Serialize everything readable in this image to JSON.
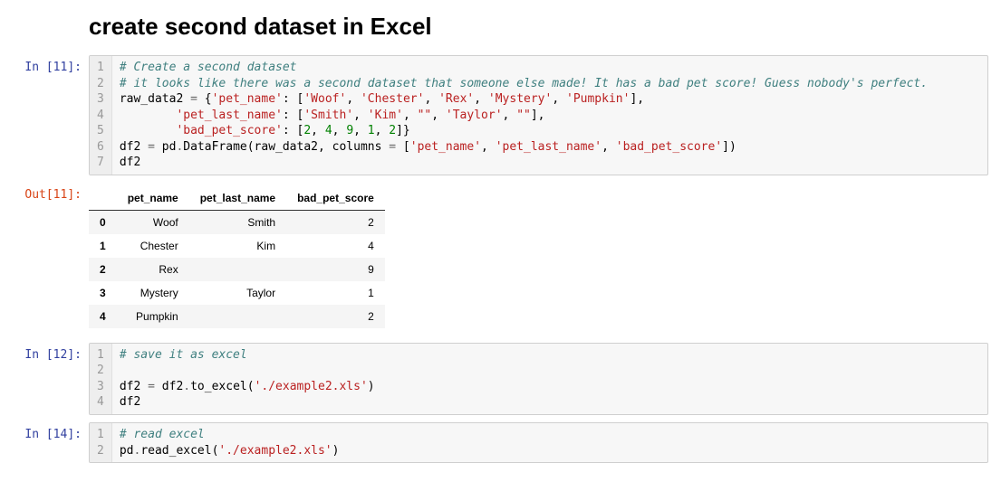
{
  "heading": "create second dataset in Excel",
  "cells": {
    "c1": {
      "prompt": "In [11]:",
      "gutter": "1\n2\n3\n4\n5\n6\n7"
    },
    "c1_code": {
      "l1": "# Create a second dataset",
      "l2": "# it looks like there was a second dataset that someone else made! It has a bad pet score! Guess nobody's perfect.",
      "l3a": "raw_data2 ",
      "l3op": "=",
      "l3b": " {",
      "l3s1": "'pet_name'",
      "l3c": ": [",
      "l3s2": "'Woof'",
      "l3d": ", ",
      "l3s3": "'Chester'",
      "l3e": ", ",
      "l3s4": "'Rex'",
      "l3f": ", ",
      "l3s5": "'Mystery'",
      "l3g": ", ",
      "l3s6": "'Pumpkin'",
      "l3h": "],",
      "l4a": "        ",
      "l4s1": "'pet_last_name'",
      "l4b": ": [",
      "l4s2": "'Smith'",
      "l4c": ", ",
      "l4s3": "'Kim'",
      "l4d": ", ",
      "l4s4": "\"\"",
      "l4e": ", ",
      "l4s5": "'Taylor'",
      "l4f": ", ",
      "l4s6": "\"\"",
      "l4g": "],",
      "l5a": "        ",
      "l5s1": "'bad_pet_score'",
      "l5b": ": [",
      "l5n1": "2",
      "l5c": ", ",
      "l5n2": "4",
      "l5d": ", ",
      "l5n3": "9",
      "l5e": ", ",
      "l5n4": "1",
      "l5f": ", ",
      "l5n5": "2",
      "l5g": "]}",
      "l6a": "df2 ",
      "l6op": "=",
      "l6b": " pd",
      "l6c": ".",
      "l6d": "DataFrame(raw_data2, columns ",
      "l6op2": "=",
      "l6e": " [",
      "l6s1": "'pet_name'",
      "l6f": ", ",
      "l6s2": "'pet_last_name'",
      "l6g": ", ",
      "l6s3": "'bad_pet_score'",
      "l6h": "])",
      "l7": "df2"
    },
    "out1": {
      "prompt": "Out[11]:"
    },
    "table": {
      "headers": [
        "",
        "pet_name",
        "pet_last_name",
        "bad_pet_score"
      ],
      "rows": [
        {
          "idx": "0",
          "c1": "Woof",
          "c2": "Smith",
          "c3": "2"
        },
        {
          "idx": "1",
          "c1": "Chester",
          "c2": "Kim",
          "c3": "4"
        },
        {
          "idx": "2",
          "c1": "Rex",
          "c2": "",
          "c3": "9"
        },
        {
          "idx": "3",
          "c1": "Mystery",
          "c2": "Taylor",
          "c3": "1"
        },
        {
          "idx": "4",
          "c1": "Pumpkin",
          "c2": "",
          "c3": "2"
        }
      ]
    },
    "c2": {
      "prompt": "In [12]:",
      "gutter": "1\n2\n3\n4"
    },
    "c2_code": {
      "l1": "# save it as excel",
      "l2": "",
      "l3a": "df2 ",
      "l3op": "=",
      "l3b": " df2",
      "l3c": ".",
      "l3d": "to_excel(",
      "l3s1": "'./example2.xls'",
      "l3e": ")",
      "l4": "df2"
    },
    "c3": {
      "prompt": "In [14]:",
      "gutter": "1\n2"
    },
    "c3_code": {
      "l1": "# read excel",
      "l2a": "pd",
      "l2b": ".",
      "l2c": "read_excel(",
      "l2s1": "'./example2.xls'",
      "l2d": ")"
    }
  },
  "chart_data": {
    "type": "table",
    "title": "df2 DataFrame",
    "columns": [
      "pet_name",
      "pet_last_name",
      "bad_pet_score"
    ],
    "index": [
      0,
      1,
      2,
      3,
      4
    ],
    "data": [
      [
        "Woof",
        "Smith",
        2
      ],
      [
        "Chester",
        "Kim",
        4
      ],
      [
        "Rex",
        "",
        9
      ],
      [
        "Mystery",
        "Taylor",
        1
      ],
      [
        "Pumpkin",
        "",
        2
      ]
    ]
  }
}
